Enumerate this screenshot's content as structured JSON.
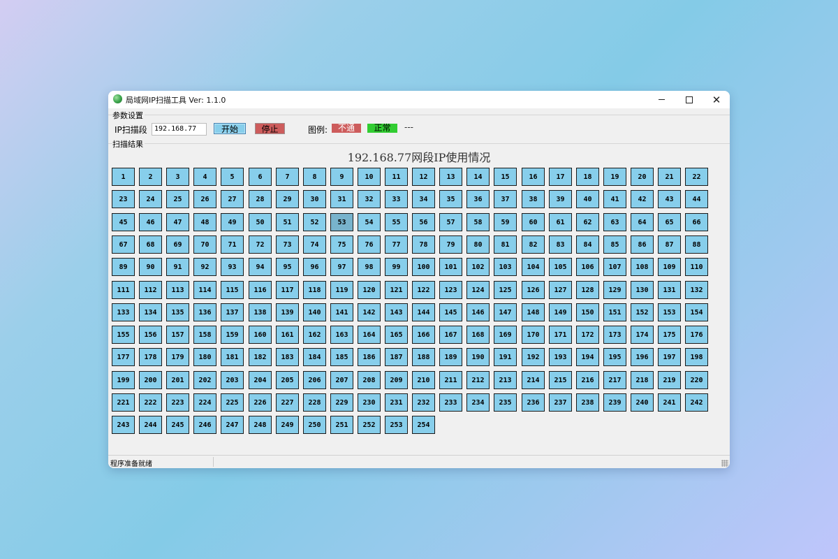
{
  "window": {
    "title": "局域网IP扫描工具  Ver: 1.1.0",
    "controls": {
      "minimize": "–",
      "maximize": "□",
      "close": "✕"
    }
  },
  "settings": {
    "group_label": "参数设置",
    "ip_label": "IP扫描段",
    "ip_value": "192.168.77",
    "start_label": "开始",
    "stop_label": "停止",
    "legend_label": "图例:",
    "legend_unreachable": "不通",
    "legend_normal": "正常",
    "legend_extra": "---"
  },
  "results": {
    "group_label": "扫描结果",
    "heading": "192.168.77网段IP使用情况",
    "cell_count": 254,
    "highlighted_cell": 53,
    "cell_color": "#87ceeb"
  },
  "colors": {
    "unreachable": "#cd5c5c",
    "normal": "#32cd32",
    "cell": "#87ceeb"
  },
  "status": {
    "text": "程序准备就绪"
  }
}
